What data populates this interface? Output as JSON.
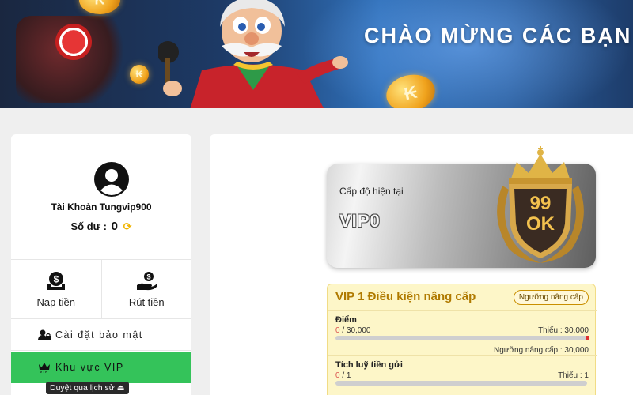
{
  "banner": {
    "title": "CHÀO MỪNG CÁC BẠN Đ"
  },
  "sidebar": {
    "account_label": "Tài Khoản Tungvip900",
    "balance_label": "Số dư :",
    "balance_value": "0",
    "quick_actions": [
      {
        "label": "Nạp tiền",
        "icon": "deposit-icon"
      },
      {
        "label": "Rút tiền",
        "icon": "withdraw-icon"
      }
    ],
    "menu": [
      {
        "label": "Cài đặt bảo mật",
        "icon": "user-lock-icon"
      },
      {
        "label": "Khu vực VIP",
        "icon": "crown-vip-icon",
        "active": true
      }
    ],
    "history_tooltip": "Duyệt qua lịch sử ⏏"
  },
  "level": {
    "current_label": "Cấp độ hiện tại",
    "current_value": "VIP0",
    "badge_text": "99OK"
  },
  "conditions": {
    "title": "VIP 1 Điều kiện nâng cấp",
    "threshold_button": "Ngưỡng nâng cấp",
    "rows": [
      {
        "label": "Điểm",
        "current": "0",
        "target": " / 30,000",
        "shortfall": "Thiếu : 30,000",
        "threshold": "Ngưỡng nâng cấp : 30,000",
        "progress": 0
      },
      {
        "label": "Tích luỹ tiền gửi",
        "current": "0",
        "target": " / 1",
        "shortfall": "Thiếu : 1",
        "progress": 0
      }
    ]
  },
  "colors": {
    "accent_green": "#34c35a",
    "gold_text": "#b07a00",
    "progress_red": "#e03030"
  }
}
